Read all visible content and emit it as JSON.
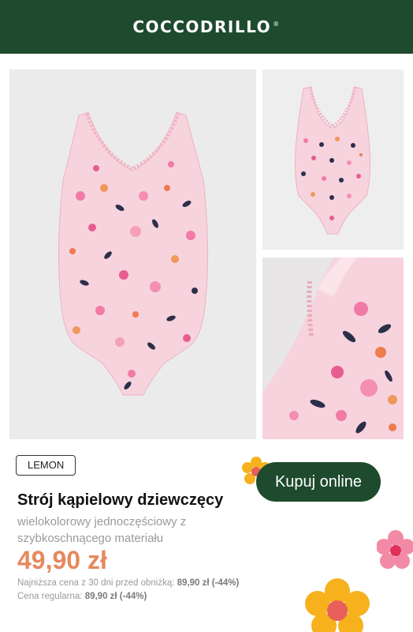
{
  "header": {
    "brand": "COCCODRILLO",
    "registered": "®"
  },
  "gallery": {
    "main_alt": "Strój kąpielowy - przód",
    "back_alt": "Strój kąpielowy - tył",
    "detail_alt": "Strój kąpielowy - detal"
  },
  "product": {
    "collection_badge": "LEMON",
    "title": "Strój kąpielowy dziewczęcy",
    "description": "wielokolorowy jednoczęściowy z szybkoschnącego materiału",
    "price": "49,90 zł",
    "lowest_price_label": "Najniższa cena z 30 dni przed obniżką:",
    "lowest_price_value": "89,90 zł (-44%)",
    "regular_price_label": "Cena regularna:",
    "regular_price_value": "89,90 zł (-44%)"
  },
  "cta": {
    "buy_label": "Kupuj online"
  },
  "colors": {
    "brand_green": "#1e4a2e",
    "price_orange": "#e5895f",
    "swimsuit_pink": "#f7d3dd"
  }
}
